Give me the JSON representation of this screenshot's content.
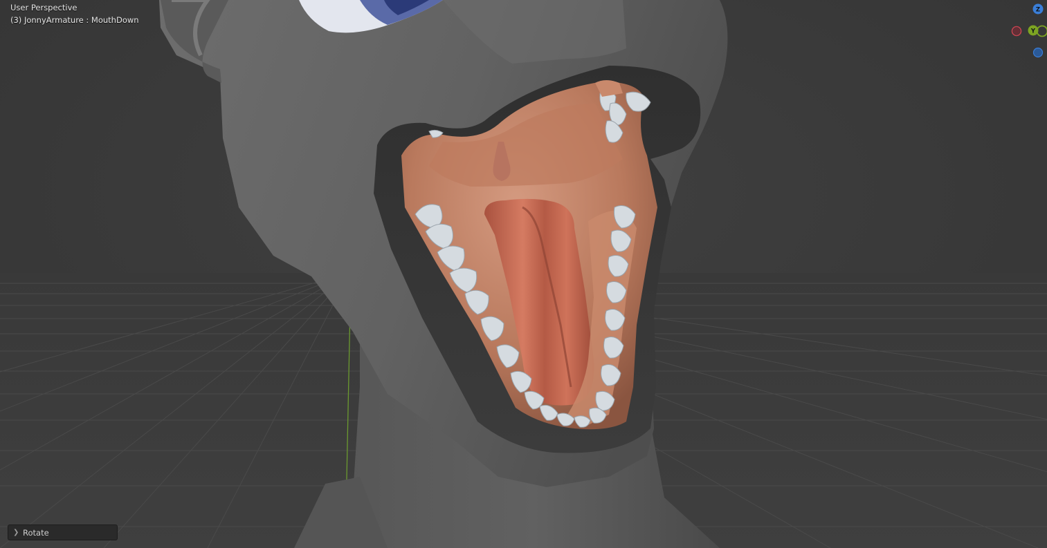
{
  "viewport": {
    "view_name": "User Perspective",
    "object_info": "(3) JonnyArmature : MouthDown"
  },
  "operator_panel": {
    "label": "Rotate"
  },
  "navigation_gizmo": {
    "axes": [
      "Z",
      "Y"
    ],
    "colors": {
      "x": "#c8404e",
      "y": "#7da422",
      "z": "#3a7ed8"
    }
  },
  "colors": {
    "background": "#3a3a3a",
    "grid_line": "#4a4a4a",
    "y_axis_line": "#6b9a2f",
    "model_gray": "#6a6a6a",
    "mouth_interior": "#c98a70",
    "tongue": "#c56a55",
    "teeth": "#d5dbe0",
    "eye_iris": "#5a6aa8"
  }
}
